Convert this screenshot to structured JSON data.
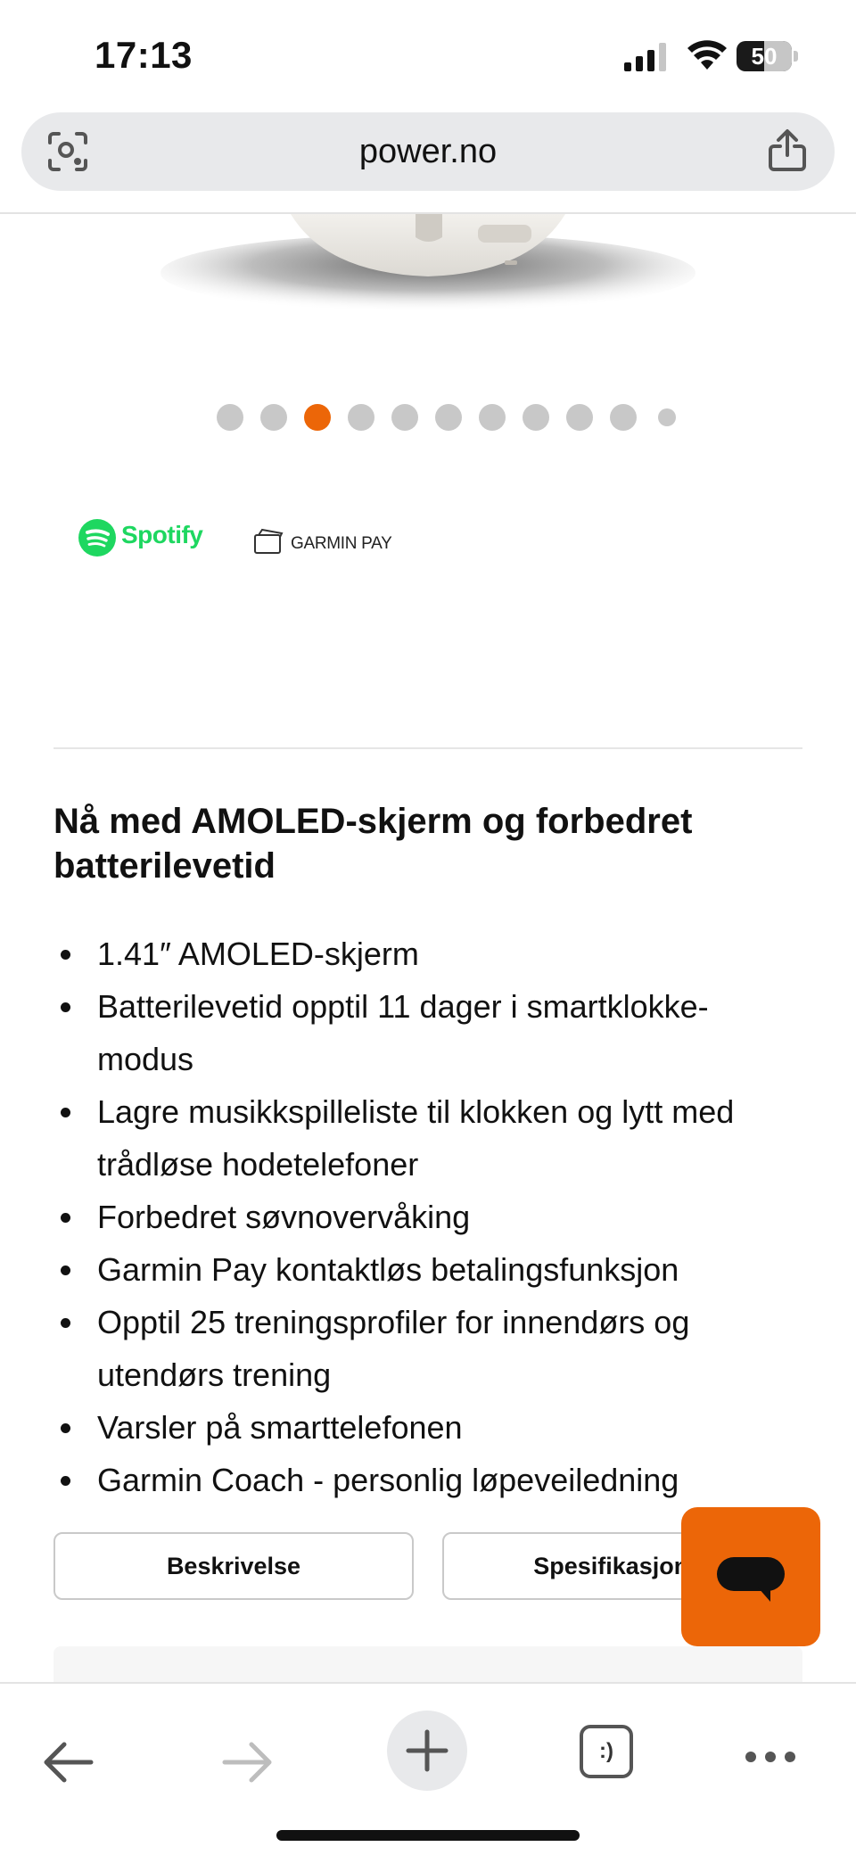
{
  "status_bar": {
    "time": "17:13",
    "battery": "50",
    "battery_level": 0.5
  },
  "browser": {
    "url": "power.no"
  },
  "carousel": {
    "total_dots": 11,
    "active_index": 2
  },
  "brands": {
    "spotify": "Spotify",
    "garmin_pay": "GARMIN PAY"
  },
  "content": {
    "heading": "Nå med AMOLED-skjerm og forbedret batterilevetid",
    "bullets": [
      "1.41″ AMOLED-skjerm",
      "Batterilevetid opptil 11 dager i smartklokke-modus",
      "Lagre musikkspilleliste til klokken og lytt med trådløse hodetelefoner",
      "Forbedret søvnovervåking",
      "Garmin Pay kontaktløs betalingsfunksjon",
      "Opptil 25 treningsprofiler for innendørs og utendørs trening",
      "Varsler på smarttelefonen",
      "Garmin Coach - personlig løpeveiledning"
    ]
  },
  "tabs": {
    "description": "Beskrivelse",
    "specifications": "Spesifikasjoner"
  },
  "toolbar": {
    "tabs_label": ":)"
  },
  "colors": {
    "accent": "#ec6608",
    "spotify_green": "#1ed760"
  },
  "icons": [
    "camera-search-icon",
    "share-icon",
    "chat-icon",
    "back-arrow-icon",
    "forward-arrow-icon",
    "plus-icon",
    "tabs-icon",
    "more-icon"
  ]
}
